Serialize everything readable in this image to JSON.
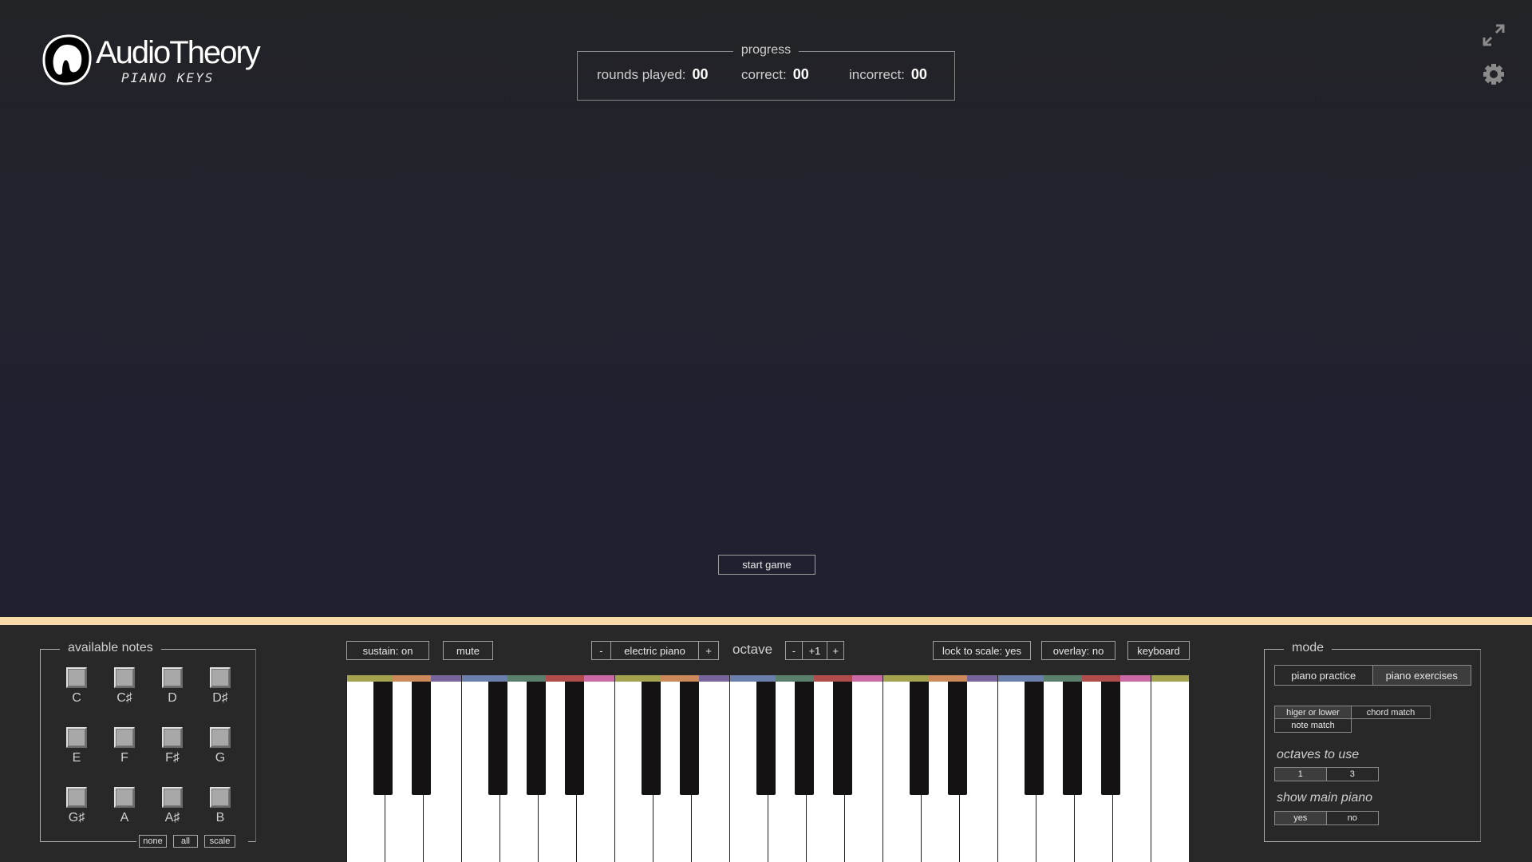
{
  "logo": {
    "title": "AudioTheory",
    "subtitle": "PIANO KEYS"
  },
  "progress": {
    "legend": "progress",
    "rounds_label": "rounds played:",
    "rounds_value": "00",
    "correct_label": "correct:",
    "correct_value": "00",
    "incorrect_label": "incorrect:",
    "incorrect_value": "00"
  },
  "top_icons": {
    "fullscreen": "fullscreen-icon",
    "settings": "gear-icon"
  },
  "start_game_label": "start game",
  "available_notes": {
    "legend": "available notes",
    "notes": [
      "C",
      "C♯",
      "D",
      "D♯",
      "E",
      "F",
      "F♯",
      "G",
      "G♯",
      "A",
      "A♯",
      "B"
    ],
    "buttons": {
      "none": "none",
      "all": "all",
      "scale": "scale"
    }
  },
  "controls": {
    "sustain": "sustain: on",
    "mute": "mute",
    "instrument": {
      "prev": "-",
      "value": "electric piano",
      "next": "+"
    },
    "octave": {
      "label": "octave",
      "dec": "-",
      "value": "+1",
      "inc": "+"
    },
    "lock_to_scale": "lock to scale: yes",
    "overlay": "overlay: no",
    "keyboard": "keyboard"
  },
  "keyboard": {
    "octaves": 3,
    "extra_top_c": true,
    "note_colors": {
      "C": "#a3a34f",
      "C#": "#a3a34f",
      "D": "#cc8a5a",
      "D#": "#cc8a5a",
      "E": "#78659a",
      "F": "#6b7fac",
      "F#": "#6b7fac",
      "G": "#5a7f6c",
      "G#": "#5a7f6c",
      "A": "#b04c4c",
      "A#": "#b04c4c",
      "B": "#c96aa6"
    }
  },
  "mode": {
    "legend": "mode",
    "tabs": [
      {
        "label": "piano practice",
        "active": false
      },
      {
        "label": "piano exercises",
        "active": true
      }
    ],
    "exercises": [
      {
        "label": "higer or lower",
        "active": true
      },
      {
        "label": "chord match",
        "active": false
      },
      {
        "label": "note match",
        "active": false
      }
    ],
    "octaves_label": "octaves to use",
    "octaves_options": [
      {
        "label": "1",
        "active": true
      },
      {
        "label": "3",
        "active": false
      }
    ],
    "show_piano_label": "show main piano",
    "show_piano_options": [
      {
        "label": "yes",
        "active": true
      },
      {
        "label": "no",
        "active": false
      }
    ]
  }
}
